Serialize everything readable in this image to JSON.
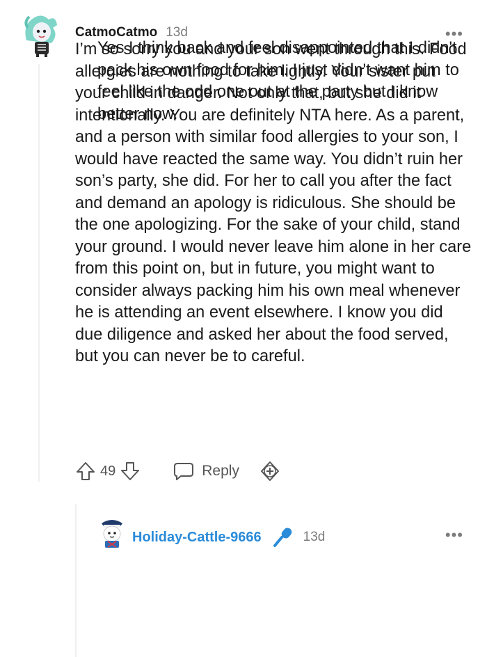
{
  "comment": {
    "author": "CatmoCatmo",
    "time": "13d",
    "text": "I’m so sorry you and your son went through this. Food allergies are nothing to take lightly. Your sister put your child in danger. Not only that, but she did it intentionally. You are definitely NTA here. As a parent, and a person with similar food allergies to your son, I would have reacted the same way. You didn’t ruin her son’s party, she did. For her to call you after the fact and demand an apology is ridiculous. She should be the one apologizing. For the sake of your child, stand your ground. I would never leave him alone in her care from this point on, but in future, you might want to consider always packing him his own meal whenever he is attending an event elsewhere. I know you did due diligence and asked her about the food served, but you can never be to careful.",
    "score": "49",
    "reply_label": "Reply",
    "more_label": "•••"
  },
  "reply": {
    "author": "Holiday-Cattle-9666",
    "time": "13d",
    "text": "Yes I think back and feel disappointed that I didn't pack his own food for him. I just didn't want him to feel like the odd one out at the party but I know better now.",
    "more_label": "•••"
  },
  "icons": {
    "upvote": "upvote-icon",
    "downvote": "downvote-icon",
    "reply": "reply-bubble-icon",
    "award": "award-plus-icon",
    "mic": "microphone-icon",
    "more": "more-options-icon"
  },
  "colors": {
    "op_accent": "#2a8bd8",
    "muted": "#7c7c7c",
    "text": "#1a1a1b"
  }
}
